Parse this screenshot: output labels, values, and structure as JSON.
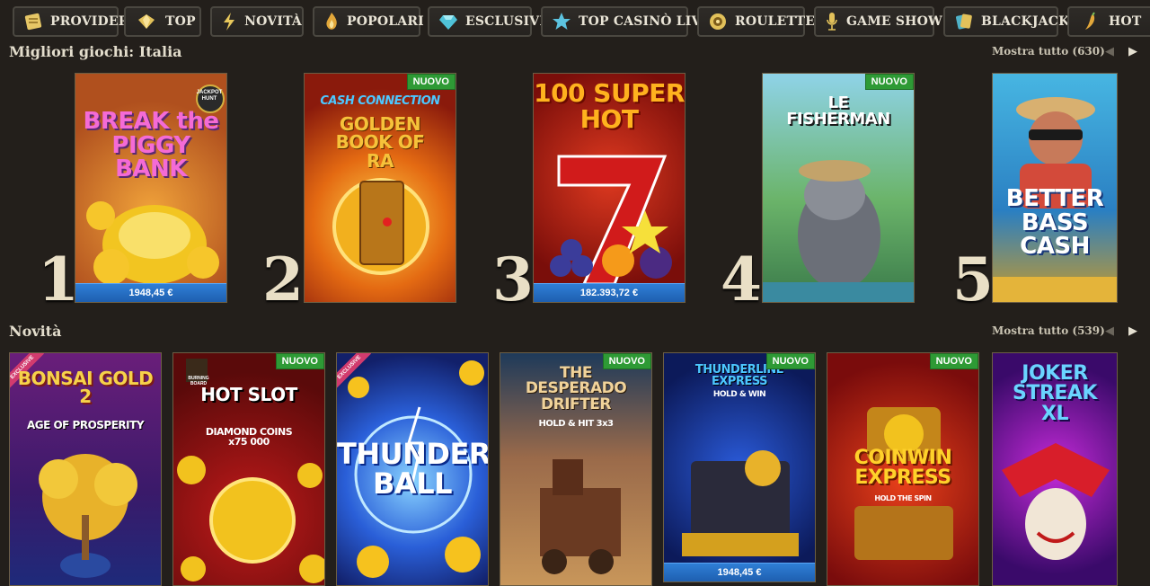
{
  "categories": [
    {
      "label": "PROVIDER",
      "icon": "scroll-icon"
    },
    {
      "label": "TOP",
      "icon": "diamond-icon"
    },
    {
      "label": "NOVITÀ",
      "icon": "lightning-icon"
    },
    {
      "label": "POPOLARI",
      "icon": "flame-icon"
    },
    {
      "label": "ESCLUSIVI",
      "icon": "gem-icon"
    },
    {
      "label": "TOP CASINÒ LIVE",
      "icon": "star-icon"
    },
    {
      "label": "ROULETTE",
      "icon": "roulette-icon"
    },
    {
      "label": "GAME SHOW",
      "icon": "microphone-icon"
    },
    {
      "label": "BLACKJACK",
      "icon": "cards-icon"
    },
    {
      "label": "HOT",
      "icon": "chili-icon"
    }
  ],
  "top_section": {
    "title": "Migliori giochi: Italia",
    "show_all": "Mostra tutto (630)",
    "games": [
      {
        "rank": "1",
        "name": "BREAK the PIGGY BANK",
        "logo": "JACKPOT HUNT",
        "jackpot": "1948,45 €",
        "badge": ""
      },
      {
        "rank": "2",
        "name": "GOLDEN BOOK OF RA",
        "logo": "CASH CONNECTION",
        "jackpot": "",
        "badge": "NUOVO"
      },
      {
        "rank": "3",
        "name": "100 SUPER HOT",
        "logo": "",
        "jackpot": "182.393,72 €",
        "badge": ""
      },
      {
        "rank": "4",
        "name": "LE FISHERMAN",
        "logo": "",
        "jackpot": "",
        "badge": "NUOVO"
      },
      {
        "rank": "5",
        "name": "BETTER BASS CASH",
        "logo": "",
        "jackpot": "",
        "badge": ""
      }
    ]
  },
  "new_section": {
    "title": "Novità",
    "show_all": "Mostra tutto (539)",
    "games": [
      {
        "name": "BONSAI GOLD 2",
        "subtitle": "AGE OF PROSPERITY",
        "badge": "",
        "exclusive": "EXCLUSIVE",
        "jackpot": ""
      },
      {
        "name": "HOT SLOT",
        "subtitle": "DIAMOND COINS x75 000",
        "logo": "BURNING BOARD",
        "badge": "NUOVO",
        "exclusive": "",
        "jackpot": ""
      },
      {
        "name": "THUNDER BALL",
        "subtitle": "",
        "badge": "",
        "exclusive": "EXCLUSIVE",
        "jackpot": ""
      },
      {
        "name": "THE DESPERADO DRIFTER",
        "subtitle": "HOLD & HIT 3x3",
        "badge": "NUOVO",
        "exclusive": "",
        "jackpot": ""
      },
      {
        "name": "THUNDERLINE EXPRESS",
        "subtitle": "HOLD & WIN",
        "badge": "NUOVO",
        "exclusive": "",
        "jackpot": "1948,45 €"
      },
      {
        "name": "COINWIN EXPRESS",
        "subtitle": "HOLD THE SPIN",
        "badge": "NUOVO",
        "exclusive": "",
        "jackpot": ""
      },
      {
        "name": "JOKER STREAK XL",
        "subtitle": "",
        "badge": "",
        "exclusive": "",
        "jackpot": ""
      }
    ]
  },
  "colors": {
    "background": "#231f1b",
    "new_badge": "#2e9a35",
    "jackpot_bar": "#1e5fb0",
    "card_border": "#6c5e44"
  }
}
